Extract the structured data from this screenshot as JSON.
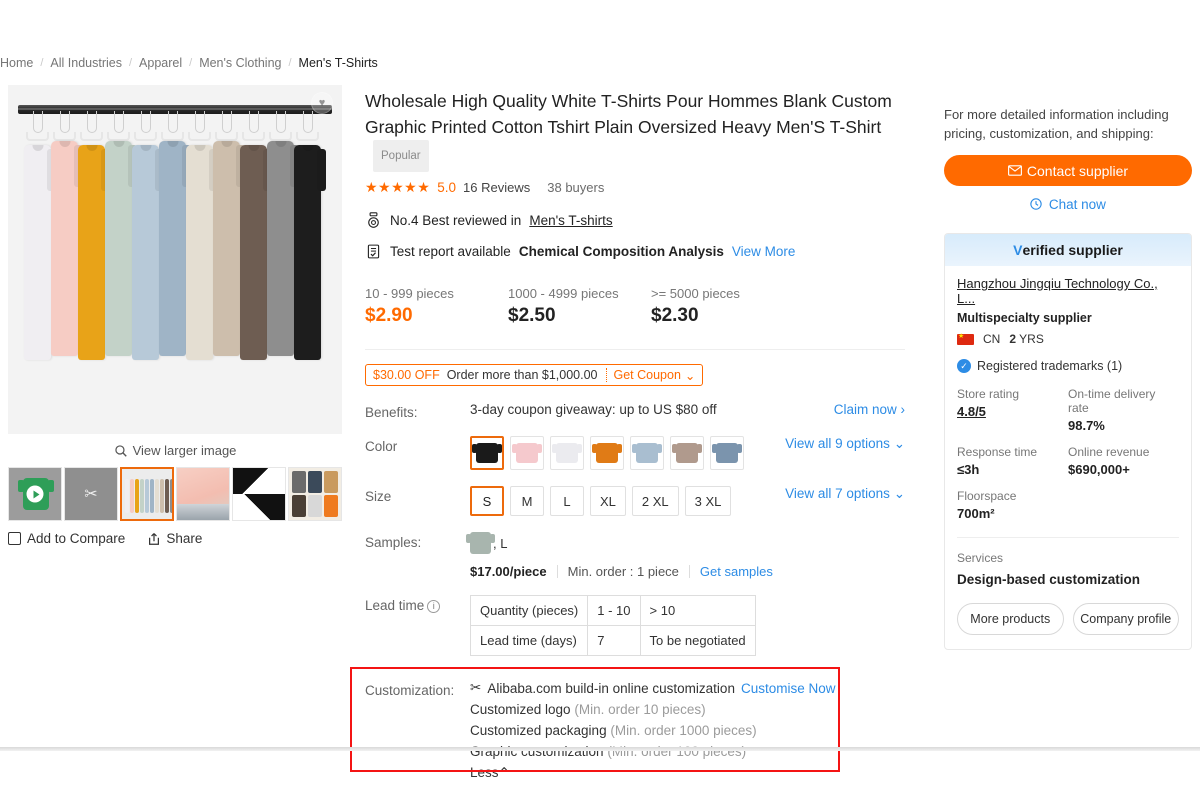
{
  "breadcrumb": {
    "items": [
      "Home",
      "All Industries",
      "Apparel",
      "Men's Clothing",
      "Men's T-Shirts"
    ],
    "separator": "/"
  },
  "gallery": {
    "view_larger_label": "View larger image",
    "search_icon": "search-icon",
    "wishlist_icon": "heart-icon",
    "add_to_compare_label": "Add to Compare",
    "share_label": "Share",
    "share_icon": "share-icon",
    "selected_thumb_index": 2,
    "thumbnails": [
      {
        "name": "video-thumbnail",
        "icon": "play-icon"
      },
      {
        "name": "customization-thumbnail",
        "icon": "scissors-icon"
      },
      {
        "name": "shirts-on-rack-thumbnail",
        "icon": ""
      },
      {
        "name": "pink-shirt-detail-thumbnail",
        "icon": ""
      },
      {
        "name": "black-white-fabric-thumbnail",
        "icon": ""
      },
      {
        "name": "packaging-collage-thumbnail",
        "icon": ""
      }
    ],
    "main_image_colors": [
      "#f0eef2",
      "#f6ccc4",
      "#e8a318",
      "#c3d2c8",
      "#b7c9d8",
      "#9fb4c6",
      "#e4ded2",
      "#cdbeac",
      "#6e5d52",
      "#8e8e8e",
      "#1d1d1d"
    ]
  },
  "product": {
    "title": "Wholesale High Quality White T-Shirts Pour Hommes Blank Custom Graphic Printed Cotton Tshirt Plain Oversized Heavy Men'S T-Shirt",
    "badge": "Popular",
    "stars": "★★★★★",
    "rating": "5.0",
    "reviews": "16 Reviews",
    "buyers": "38 buyers",
    "best_reviewed_icon": "medal-icon",
    "best_reviewed_prefix": "No.4 Best reviewed in",
    "best_reviewed_category": "Men's T-shirts",
    "test_report_icon": "report-icon",
    "test_report_prefix": "Test report available",
    "test_report_name": "Chemical Composition Analysis",
    "test_report_link": "View More"
  },
  "pricing": {
    "tiers": [
      {
        "qty": "10 - 999 pieces",
        "price": "$2.90"
      },
      {
        "qty": "1000 - 4999 pieces",
        "price": "$2.50"
      },
      {
        "qty": ">= 5000 pieces",
        "price": "$2.30"
      }
    ]
  },
  "coupon": {
    "off": "$30.00 OFF",
    "condition": "Order more than $1,000.00",
    "cta": "Get Coupon",
    "chevron": "⌄",
    "accent": "#ff6a00"
  },
  "benefits": {
    "label": "Benefits:",
    "text": "3-day coupon giveaway: up to US $80 off",
    "claim": "Claim now",
    "claim_chevron": "›"
  },
  "color": {
    "label": "Color",
    "view_all": "View all 9 options",
    "chevron": "⌄",
    "selected_index": 0,
    "swatches": [
      {
        "name": "black",
        "hex": "#1a1a1a"
      },
      {
        "name": "pink",
        "hex": "#f5c9cd"
      },
      {
        "name": "white",
        "hex": "#ebebef"
      },
      {
        "name": "orange",
        "hex": "#e07b16"
      },
      {
        "name": "light-blue",
        "hex": "#a9bed0"
      },
      {
        "name": "taupe",
        "hex": "#b09a8d"
      },
      {
        "name": "slate-blue",
        "hex": "#7b94ad"
      }
    ]
  },
  "size": {
    "label": "Size",
    "options": [
      "S",
      "M",
      "L",
      "XL",
      "2 XL",
      "3 XL"
    ],
    "selected": "S",
    "view_all": "View all 7 options",
    "chevron": "⌄"
  },
  "samples": {
    "label": "Samples:",
    "variant": ", L",
    "price": "$17.00/piece",
    "min_order": "Min. order : 1 piece",
    "cta": "Get samples"
  },
  "lead_time": {
    "label": "Lead time",
    "info_icon": "info-icon",
    "rows": [
      {
        "header": "Quantity (pieces)",
        "cells": [
          "1 - 10",
          "> 10"
        ]
      },
      {
        "header": "Lead time (days)",
        "cells": [
          "7",
          "To be negotiated"
        ]
      }
    ]
  },
  "customization": {
    "label": "Customization:",
    "builtin_icon": "scissors-icon",
    "builtin_text": "Alibaba.com build-in online customization",
    "customise_now": "Customise Now",
    "options": [
      {
        "name": "Customized logo",
        "min": "(Min. order 10 pieces)"
      },
      {
        "name": "Customized packaging",
        "min": "(Min. order 1000 pieces)"
      },
      {
        "name": "Graphic customization",
        "min": "(Min. order 100 pieces)"
      }
    ],
    "less_label": "Less",
    "less_chevron": "⌃",
    "highlight_color": "#f41414"
  },
  "sidebar": {
    "note": "For more detailed information including pricing, customization, and shipping:",
    "contact_button": "Contact supplier",
    "contact_icon": "envelope-icon",
    "chat_now": "Chat now",
    "chat_icon": "clock-icon",
    "verified_label": "Verified supplier",
    "supplier_name": "Hangzhou Jingqiu Technology Co., L...",
    "supplier_type": "Multispecialty supplier",
    "country_code": "CN",
    "years": "2",
    "years_unit": "YRS",
    "trademark": "Registered trademarks (1)",
    "stats": [
      {
        "label": "Store rating",
        "value": "4.8/5",
        "link": true
      },
      {
        "label": "On-time delivery rate",
        "value": "98.7%",
        "link": false
      },
      {
        "label": "Response time",
        "value": "≤3h",
        "link": false
      },
      {
        "label": "Online revenue",
        "value": "$690,000+",
        "link": false
      },
      {
        "label": "Floorspace",
        "value": "700m²",
        "link": false
      }
    ],
    "services_label": "Services",
    "services_value": "Design-based customization",
    "more_products": "More products",
    "company_profile": "Company profile"
  }
}
